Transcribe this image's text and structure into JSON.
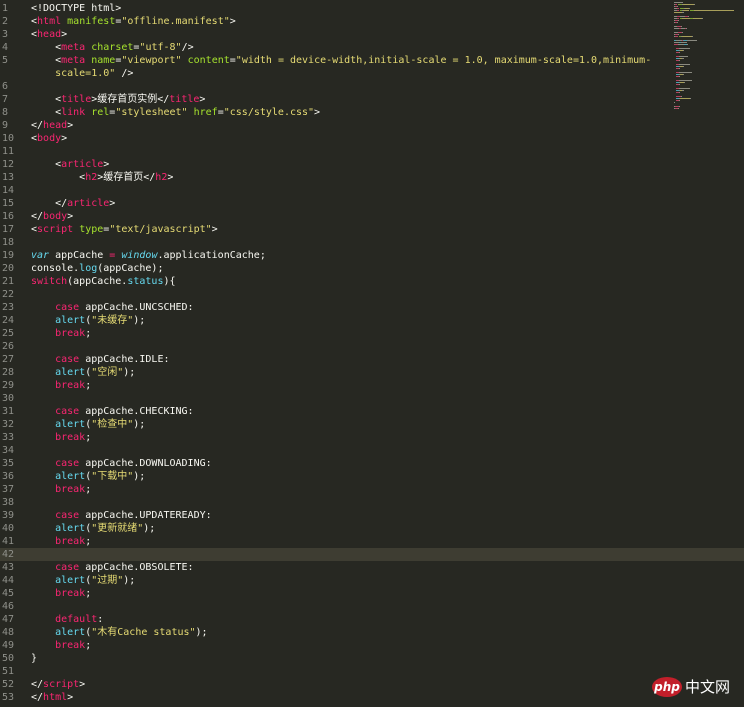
{
  "editor": {
    "highlight_line": 42,
    "lines": [
      {
        "n": "1",
        "tokens": [
          [
            "t-plain",
            "<!DOCTYPE html>"
          ]
        ]
      },
      {
        "n": "2",
        "tokens": [
          [
            "t-plain",
            "<"
          ],
          [
            "t-tag",
            "html"
          ],
          [
            "t-plain",
            " "
          ],
          [
            "t-attr",
            "manifest"
          ],
          [
            "t-plain",
            "="
          ],
          [
            "t-str",
            "\"offline.manifest\""
          ],
          [
            "t-plain",
            ">"
          ]
        ]
      },
      {
        "n": "3",
        "tokens": [
          [
            "t-plain",
            "<"
          ],
          [
            "t-tag",
            "head"
          ],
          [
            "t-plain",
            ">"
          ]
        ]
      },
      {
        "n": "4",
        "tokens": [
          [
            "t-plain",
            "    <"
          ],
          [
            "t-tag",
            "meta"
          ],
          [
            "t-plain",
            " "
          ],
          [
            "t-attr",
            "charset"
          ],
          [
            "t-plain",
            "="
          ],
          [
            "t-str",
            "\"utf-8\""
          ],
          [
            "t-plain",
            "/>"
          ]
        ]
      },
      {
        "n": "5",
        "tokens": [
          [
            "t-plain",
            "    <"
          ],
          [
            "t-tag",
            "meta"
          ],
          [
            "t-plain",
            " "
          ],
          [
            "t-attr",
            "name"
          ],
          [
            "t-plain",
            "="
          ],
          [
            "t-str",
            "\"viewport\""
          ],
          [
            "t-plain",
            " "
          ],
          [
            "t-attr",
            "content"
          ],
          [
            "t-plain",
            "="
          ],
          [
            "t-str",
            "\"width = device-width,initial-scale = 1.0, maximum-scale=1.0,minimum-"
          ]
        ]
      },
      {
        "n": "",
        "tokens": [
          [
            "t-str",
            "    scale=1.0\""
          ],
          [
            "t-plain",
            " />"
          ]
        ]
      },
      {
        "n": "6",
        "tokens": []
      },
      {
        "n": "7",
        "tokens": [
          [
            "t-plain",
            "    <"
          ],
          [
            "t-tag",
            "title"
          ],
          [
            "t-plain",
            ">缓存首页实例</"
          ],
          [
            "t-tag",
            "title"
          ],
          [
            "t-plain",
            ">"
          ]
        ]
      },
      {
        "n": "8",
        "tokens": [
          [
            "t-plain",
            "    <"
          ],
          [
            "t-tag",
            "link"
          ],
          [
            "t-plain",
            " "
          ],
          [
            "t-attr",
            "rel"
          ],
          [
            "t-plain",
            "="
          ],
          [
            "t-str",
            "\"stylesheet\""
          ],
          [
            "t-plain",
            " "
          ],
          [
            "t-attr",
            "href"
          ],
          [
            "t-plain",
            "="
          ],
          [
            "t-str",
            "\"css/style.css\""
          ],
          [
            "t-plain",
            ">"
          ]
        ]
      },
      {
        "n": "9",
        "tokens": [
          [
            "t-plain",
            "</"
          ],
          [
            "t-tag",
            "head"
          ],
          [
            "t-plain",
            ">"
          ]
        ]
      },
      {
        "n": "10",
        "tokens": [
          [
            "t-plain",
            "<"
          ],
          [
            "t-tag",
            "body"
          ],
          [
            "t-plain",
            ">"
          ]
        ]
      },
      {
        "n": "11",
        "tokens": []
      },
      {
        "n": "12",
        "tokens": [
          [
            "t-plain",
            "    <"
          ],
          [
            "t-tag",
            "article"
          ],
          [
            "t-plain",
            ">"
          ]
        ]
      },
      {
        "n": "13",
        "tokens": [
          [
            "t-plain",
            "        <"
          ],
          [
            "t-tag",
            "h2"
          ],
          [
            "t-plain",
            ">缓存首页</"
          ],
          [
            "t-tag",
            "h2"
          ],
          [
            "t-plain",
            ">"
          ]
        ]
      },
      {
        "n": "14",
        "tokens": []
      },
      {
        "n": "15",
        "tokens": [
          [
            "t-plain",
            "    </"
          ],
          [
            "t-tag",
            "article"
          ],
          [
            "t-plain",
            ">"
          ]
        ]
      },
      {
        "n": "16",
        "tokens": [
          [
            "t-plain",
            "</"
          ],
          [
            "t-tag",
            "body"
          ],
          [
            "t-plain",
            ">"
          ]
        ]
      },
      {
        "n": "17",
        "tokens": [
          [
            "t-plain",
            "<"
          ],
          [
            "t-tag",
            "script"
          ],
          [
            "t-plain",
            " "
          ],
          [
            "t-attr",
            "type"
          ],
          [
            "t-plain",
            "="
          ],
          [
            "t-str",
            "\"text/javascript\""
          ],
          [
            "t-plain",
            ">"
          ]
        ]
      },
      {
        "n": "18",
        "tokens": []
      },
      {
        "n": "19",
        "tokens": [
          [
            "t-italic",
            "var"
          ],
          [
            "t-plain",
            " appCache "
          ],
          [
            "t-kw",
            "="
          ],
          [
            "t-plain",
            " "
          ],
          [
            "t-italic",
            "window"
          ],
          [
            "t-plain",
            ".applicationCache;"
          ]
        ]
      },
      {
        "n": "20",
        "tokens": [
          [
            "t-plain",
            "console."
          ],
          [
            "t-func",
            "log"
          ],
          [
            "t-plain",
            "(appCache);"
          ]
        ]
      },
      {
        "n": "21",
        "tokens": [
          [
            "t-kw",
            "switch"
          ],
          [
            "t-plain",
            "(appCache."
          ],
          [
            "t-func",
            "status"
          ],
          [
            "t-plain",
            "){"
          ]
        ]
      },
      {
        "n": "22",
        "tokens": []
      },
      {
        "n": "23",
        "tokens": [
          [
            "t-plain",
            "    "
          ],
          [
            "t-kw",
            "case"
          ],
          [
            "t-plain",
            " appCache.UNCSCHED:"
          ]
        ]
      },
      {
        "n": "24",
        "tokens": [
          [
            "t-plain",
            "    "
          ],
          [
            "t-func",
            "alert"
          ],
          [
            "t-plain",
            "("
          ],
          [
            "t-str",
            "\"未缓存\""
          ],
          [
            "t-plain",
            ");"
          ]
        ]
      },
      {
        "n": "25",
        "tokens": [
          [
            "t-plain",
            "    "
          ],
          [
            "t-kw",
            "break"
          ],
          [
            "t-plain",
            ";"
          ]
        ]
      },
      {
        "n": "26",
        "tokens": []
      },
      {
        "n": "27",
        "tokens": [
          [
            "t-plain",
            "    "
          ],
          [
            "t-kw",
            "case"
          ],
          [
            "t-plain",
            " appCache.IDLE:"
          ]
        ]
      },
      {
        "n": "28",
        "tokens": [
          [
            "t-plain",
            "    "
          ],
          [
            "t-func",
            "alert"
          ],
          [
            "t-plain",
            "("
          ],
          [
            "t-str",
            "\"空闲\""
          ],
          [
            "t-plain",
            ");"
          ]
        ]
      },
      {
        "n": "29",
        "tokens": [
          [
            "t-plain",
            "    "
          ],
          [
            "t-kw",
            "break"
          ],
          [
            "t-plain",
            ";"
          ]
        ]
      },
      {
        "n": "30",
        "tokens": []
      },
      {
        "n": "31",
        "tokens": [
          [
            "t-plain",
            "    "
          ],
          [
            "t-kw",
            "case"
          ],
          [
            "t-plain",
            " appCache.CHECKING:"
          ]
        ]
      },
      {
        "n": "32",
        "tokens": [
          [
            "t-plain",
            "    "
          ],
          [
            "t-func",
            "alert"
          ],
          [
            "t-plain",
            "("
          ],
          [
            "t-str",
            "\"检查中\""
          ],
          [
            "t-plain",
            ");"
          ]
        ]
      },
      {
        "n": "33",
        "tokens": [
          [
            "t-plain",
            "    "
          ],
          [
            "t-kw",
            "break"
          ],
          [
            "t-plain",
            ";"
          ]
        ]
      },
      {
        "n": "34",
        "tokens": []
      },
      {
        "n": "35",
        "tokens": [
          [
            "t-plain",
            "    "
          ],
          [
            "t-kw",
            "case"
          ],
          [
            "t-plain",
            " appCache.DOWNLOADING:"
          ]
        ]
      },
      {
        "n": "36",
        "tokens": [
          [
            "t-plain",
            "    "
          ],
          [
            "t-func",
            "alert"
          ],
          [
            "t-plain",
            "("
          ],
          [
            "t-str",
            "\"下载中\""
          ],
          [
            "t-plain",
            ");"
          ]
        ]
      },
      {
        "n": "37",
        "tokens": [
          [
            "t-plain",
            "    "
          ],
          [
            "t-kw",
            "break"
          ],
          [
            "t-plain",
            ";"
          ]
        ]
      },
      {
        "n": "38",
        "tokens": []
      },
      {
        "n": "39",
        "tokens": [
          [
            "t-plain",
            "    "
          ],
          [
            "t-kw",
            "case"
          ],
          [
            "t-plain",
            " appCache.UPDATEREADY:"
          ]
        ]
      },
      {
        "n": "40",
        "tokens": [
          [
            "t-plain",
            "    "
          ],
          [
            "t-func",
            "alert"
          ],
          [
            "t-plain",
            "("
          ],
          [
            "t-str",
            "\"更新就绪\""
          ],
          [
            "t-plain",
            ");"
          ]
        ]
      },
      {
        "n": "41",
        "tokens": [
          [
            "t-plain",
            "    "
          ],
          [
            "t-kw",
            "break"
          ],
          [
            "t-plain",
            ";"
          ]
        ]
      },
      {
        "n": "42",
        "tokens": []
      },
      {
        "n": "43",
        "tokens": [
          [
            "t-plain",
            "    "
          ],
          [
            "t-kw",
            "case"
          ],
          [
            "t-plain",
            " appCache.OBSOLETE:"
          ]
        ]
      },
      {
        "n": "44",
        "tokens": [
          [
            "t-plain",
            "    "
          ],
          [
            "t-func",
            "alert"
          ],
          [
            "t-plain",
            "("
          ],
          [
            "t-str",
            "\"过期\""
          ],
          [
            "t-plain",
            ");"
          ]
        ]
      },
      {
        "n": "45",
        "tokens": [
          [
            "t-plain",
            "    "
          ],
          [
            "t-kw",
            "break"
          ],
          [
            "t-plain",
            ";"
          ]
        ]
      },
      {
        "n": "46",
        "tokens": []
      },
      {
        "n": "47",
        "tokens": [
          [
            "t-plain",
            "    "
          ],
          [
            "t-kw",
            "default"
          ],
          [
            "t-plain",
            ":"
          ]
        ]
      },
      {
        "n": "48",
        "tokens": [
          [
            "t-plain",
            "    "
          ],
          [
            "t-func",
            "alert"
          ],
          [
            "t-plain",
            "("
          ],
          [
            "t-str",
            "\"木有Cache status\""
          ],
          [
            "t-plain",
            ");"
          ]
        ]
      },
      {
        "n": "49",
        "tokens": [
          [
            "t-plain",
            "    "
          ],
          [
            "t-kw",
            "break"
          ],
          [
            "t-plain",
            ";"
          ]
        ]
      },
      {
        "n": "50",
        "tokens": [
          [
            "t-plain",
            "}"
          ]
        ]
      },
      {
        "n": "51",
        "tokens": []
      },
      {
        "n": "52",
        "tokens": [
          [
            "t-plain",
            "</"
          ],
          [
            "t-tag",
            "script"
          ],
          [
            "t-plain",
            ">"
          ]
        ]
      },
      {
        "n": "53",
        "tokens": [
          [
            "t-plain",
            "</"
          ],
          [
            "t-tag",
            "html"
          ],
          [
            "t-plain",
            ">"
          ]
        ]
      }
    ]
  },
  "colors": {
    "background": "#272822",
    "tag": "#f92672",
    "attribute": "#a6e22e",
    "string": "#e6db74",
    "function": "#66d9ef",
    "line_number": "#8f908a",
    "current_line": "#3e3d32"
  },
  "minimap": {
    "icon": "minimap"
  },
  "watermark": {
    "logo_text": "php",
    "site_text": "中文网"
  }
}
